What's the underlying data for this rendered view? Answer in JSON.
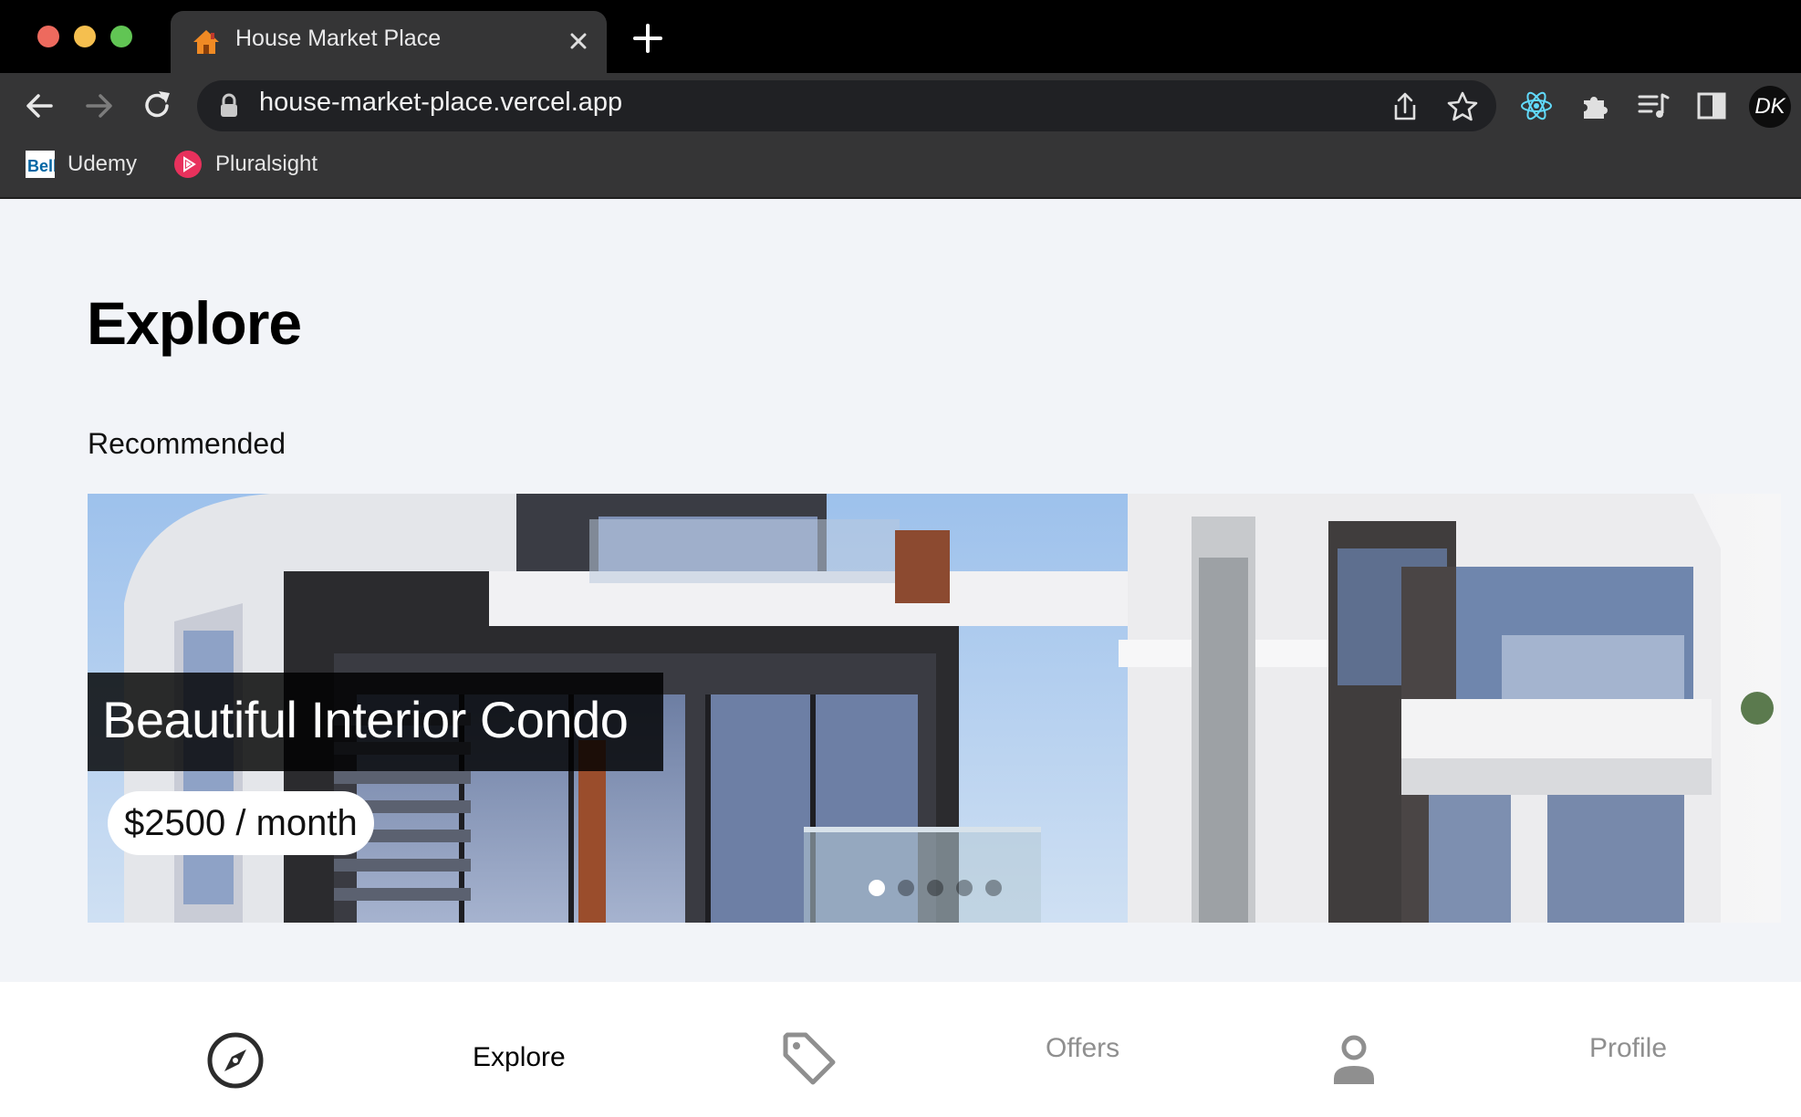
{
  "browser": {
    "tab": {
      "title": "House Market Place",
      "favicon": "house-icon"
    },
    "new_tab_icon": "plus-icon",
    "address": {
      "url": "house-market-place.vercel.app",
      "lock_icon": "lock-icon"
    },
    "toolbar_icons": [
      "share-icon",
      "star-icon",
      "react-devtools-icon",
      "extensions-icon",
      "reading-list-icon",
      "side-panel-icon"
    ],
    "profile_initials": "DK",
    "bookmarks": [
      {
        "label": "Udemy",
        "icon": "bell-logo-icon"
      },
      {
        "label": "Pluralsight",
        "icon": "pluralsight-icon"
      }
    ]
  },
  "page": {
    "title": "Explore",
    "section_label": "Recommended",
    "featured": {
      "title": "Beautiful Interior Condo",
      "price": "$2500 / month",
      "slide_count": 5,
      "active_slide": 1
    }
  },
  "navbar": {
    "items": [
      {
        "label": "Explore",
        "icon": "compass-icon",
        "active": true
      },
      {
        "label": "Offers",
        "icon": "tag-icon",
        "active": false
      },
      {
        "label": "Profile",
        "icon": "person-icon",
        "active": false
      }
    ]
  },
  "colors": {
    "page_background": "#f2f4f8",
    "active_nav": "#000000",
    "inactive_nav": "#8f8f8f"
  }
}
